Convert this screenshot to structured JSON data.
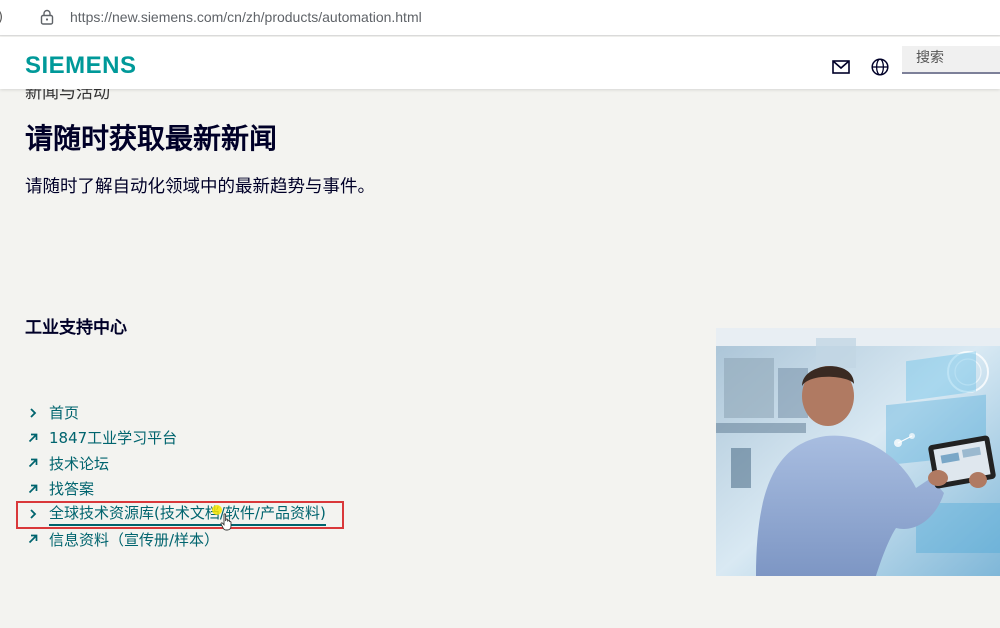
{
  "browser": {
    "url": "https://new.siemens.com/cn/zh/products/automation.html"
  },
  "header": {
    "logo": "SIEMENS",
    "search_placeholder": "搜索",
    "icons": {
      "mail": "mail-icon",
      "globe": "globe-icon"
    }
  },
  "main": {
    "section_kicker": "新闻与活动",
    "headline": "请随时获取最新新闻",
    "subtitle": "请随时了解自动化领域中的最新趋势与事件。",
    "support_title": "工业支持中心",
    "links": [
      {
        "label": "首页",
        "icon": "chevron-right-icon"
      },
      {
        "label": "1847工业学习平台",
        "icon": "external-arrow-icon"
      },
      {
        "label": "技术论坛",
        "icon": "external-arrow-icon"
      },
      {
        "label": "找答案",
        "icon": "external-arrow-icon"
      },
      {
        "label": "全球技术资源库(技术文档/软件/产品资料)",
        "icon": "chevron-right-icon",
        "highlighted": true
      },
      {
        "label": "信息资料（宣传册/样本）",
        "icon": "external-arrow-icon"
      }
    ]
  },
  "colors": {
    "brand": "#009999",
    "link": "#00646e",
    "headline": "#000028",
    "highlight_box": "#d9383a",
    "background": "#f3f3f0"
  }
}
